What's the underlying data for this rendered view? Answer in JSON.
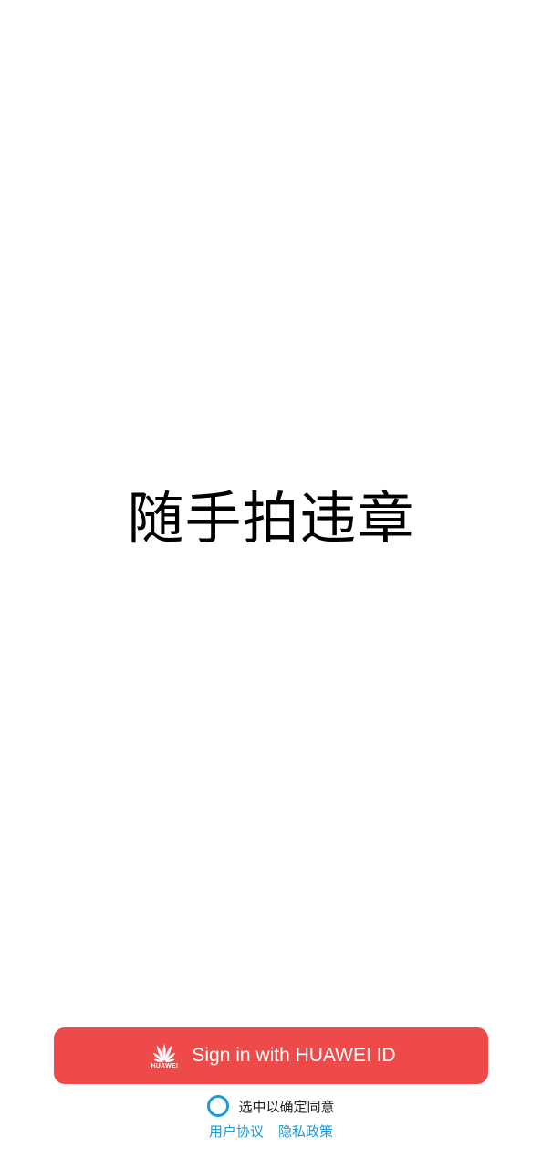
{
  "app": {
    "title": "随手拍违章"
  },
  "signin": {
    "label": "Sign in with HUAWEI ID",
    "brand_text": "HUAWEI",
    "icon": "huawei-logo-icon",
    "background_color": "#ef4a4a",
    "text_color": "#ffffff"
  },
  "agreement": {
    "text": "选中以确定同意",
    "checked": false,
    "radio_color": "#1a9bd3",
    "links": [
      {
        "label": "用户协议"
      },
      {
        "label": "隐私政策"
      }
    ],
    "link_color": "#1a9bd3"
  }
}
